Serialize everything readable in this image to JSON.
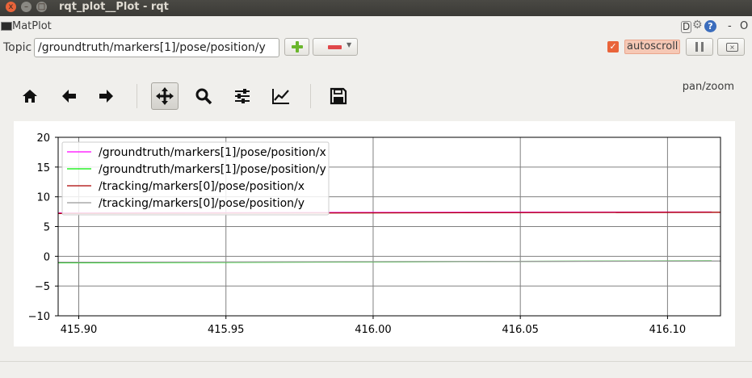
{
  "window": {
    "title": "rqt_plot__Plot - rqt",
    "close_glyph": "x",
    "min_glyph": "–",
    "max_glyph": "□"
  },
  "plugin": {
    "title": "MatPlot",
    "d_label": "D",
    "help_label": "?",
    "dash_label": "-",
    "o_label": "O"
  },
  "topic": {
    "label": "Topic",
    "value": "/groundtruth/markers[1]/pose/position/y",
    "autoscroll_label": "autoscroll",
    "autoscroll_checked": true,
    "autoscroll_mark": "✓"
  },
  "toolbar": {
    "mode_text": "pan/zoom",
    "active_tool": "pan",
    "icons": [
      "home-icon",
      "back-arrow-icon",
      "forward-arrow-icon",
      "pan-icon",
      "zoom-icon",
      "subplots-icon",
      "axes-icon",
      "save-icon"
    ]
  },
  "colors": {
    "title_bar": "#3b3a36",
    "accent": "#e9643a",
    "add": "#6ab62c",
    "remove": "#e0474a"
  },
  "chart_data": {
    "type": "line",
    "title": "",
    "xlabel": "",
    "ylabel": "",
    "xlim": [
      415.893,
      416.118
    ],
    "ylim": [
      -10,
      20
    ],
    "grid": true,
    "legend_placement": "upper-left",
    "x_ticks": [
      {
        "value": 415.9,
        "label": "415.90"
      },
      {
        "value": 415.95,
        "label": "415.95"
      },
      {
        "value": 416.0,
        "label": "416.00"
      },
      {
        "value": 416.05,
        "label": "416.05"
      },
      {
        "value": 416.1,
        "label": "416.10"
      }
    ],
    "y_ticks": [
      {
        "value": 20,
        "label": "20"
      },
      {
        "value": 15,
        "label": "15"
      },
      {
        "value": 10,
        "label": "10"
      },
      {
        "value": 5,
        "label": "5"
      },
      {
        "value": 0,
        "label": "0"
      },
      {
        "value": -5,
        "label": "−5"
      },
      {
        "value": -10,
        "label": "−10"
      }
    ],
    "series": [
      {
        "name": "/groundtruth/markers[1]/pose/position/x",
        "color": "#ff00ff",
        "x": [
          415.893,
          416.115
        ],
        "y": [
          7.3,
          7.45
        ]
      },
      {
        "name": "/groundtruth/markers[1]/pose/position/y",
        "color": "#00ee00",
        "x": [
          415.893,
          416.115
        ],
        "y": [
          -1.1,
          -0.75
        ]
      },
      {
        "name": "/tracking/markers[0]/pose/position/x",
        "color": "#aa0000",
        "x": [
          415.893,
          416.118
        ],
        "y": [
          7.2,
          7.4
        ]
      },
      {
        "name": "/tracking/markers[0]/pose/position/y",
        "color": "#999999",
        "x": [
          415.893,
          416.118
        ],
        "y": [
          -1.0,
          -0.8
        ]
      }
    ]
  }
}
